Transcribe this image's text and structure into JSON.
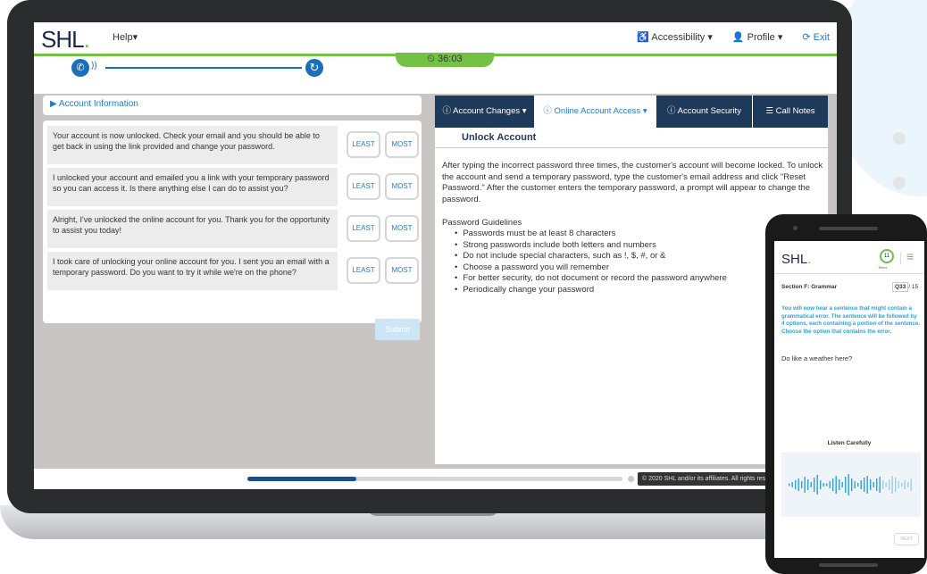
{
  "header": {
    "logo": "SHL",
    "help_label": "Help▾",
    "accessibility_label": "Accessibility ▾",
    "profile_label": "Profile ▾",
    "exit_label": "Exit",
    "timer": "36:03"
  },
  "left": {
    "account_info_label": "Account Information",
    "responses": [
      "Your account is now unlocked. Check your email and you should be able to get back in using the link provided and change your password.",
      "I unlocked your account and emailed you a link with your temporary password so you can access it. Is there anything else I can do to assist you?",
      "Alright, I've unlocked the online account for you. Thank you for the opportunity to assist you today!",
      "I took care of unlocking your online account for you. I sent you an email with a temporary password. Do you want to try it while we're on the phone?"
    ],
    "least_label": "LEAST",
    "most_label": "MOST",
    "submit_label": "Submit"
  },
  "right": {
    "tabs": [
      {
        "label": "Account Changes ▾"
      },
      {
        "label": "Online Account Access ▾"
      },
      {
        "label": "Account Security"
      },
      {
        "label": "Call Notes"
      }
    ],
    "active_tab": 1,
    "section_title": "Unlock Account",
    "body": "After typing the incorrect password three times, the customer's account will become locked. To unlock the account and send a temporary password, type the customer's email address and click \"Reset Password.\" After the customer enters the temporary password, a prompt will appear to change the password.",
    "guidelines_title": "Password Guidelines",
    "guidelines": [
      "Passwords must be at least 8 characters",
      "Strong passwords include both letters and numbers",
      "Do not include special characters, such as !, $, #, or &",
      "Choose a password you will remember",
      "For better security, do not document or record the password anywhere",
      "Periodically change your password"
    ]
  },
  "footer": {
    "progress_fraction": 0.29,
    "copyright": "© 2020 SHL and/or its affiliates. All rights reserved."
  },
  "phone": {
    "logo": "SHL",
    "timer_value": "11",
    "timer_label": "Timer",
    "section": "Section F: Grammar",
    "question_current": "Q33",
    "question_total": "/ 15",
    "instruction": "You will now hear a sentence that might contain a grammatical error. The sentence will be followed by 4 options, each containing a portion of the sentence. Choose the option that contains the error.",
    "question_text": "Do like a weather here?",
    "listen_label": "Listen Carefully",
    "next_label": "NEXT"
  },
  "colors": {
    "navy": "#1d3a5b",
    "accent_blue": "#2a7ac0",
    "brand_green": "#74c243"
  }
}
